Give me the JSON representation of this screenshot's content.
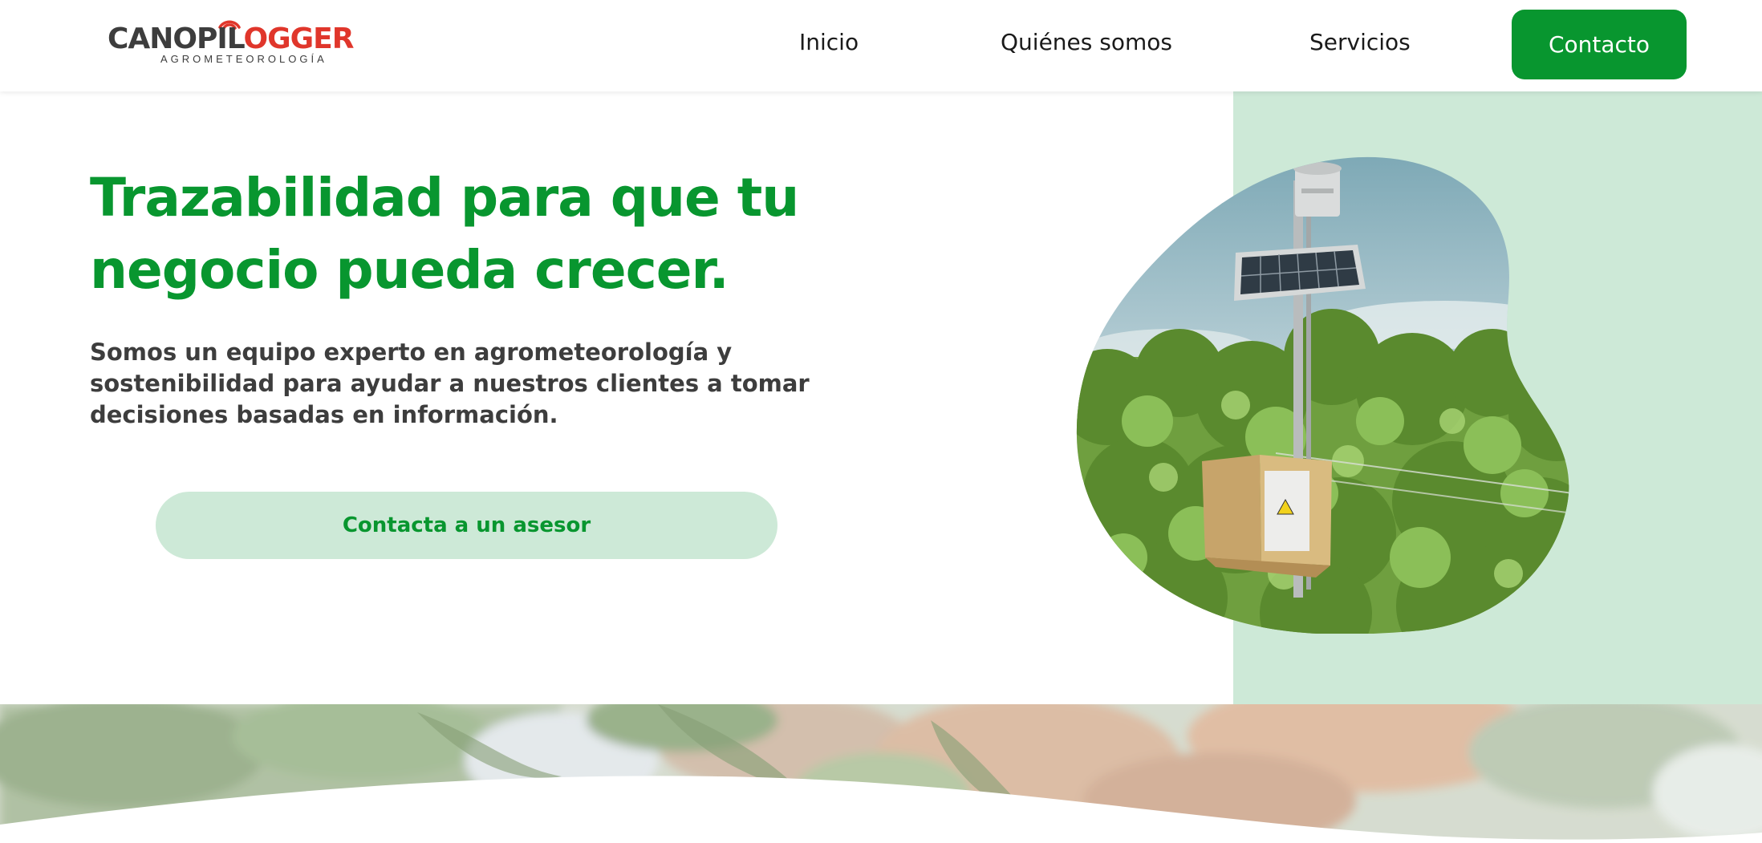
{
  "brand": {
    "logo_main_part1": "CANOPIL",
    "logo_main_o": "O",
    "logo_main_part2": "GGER",
    "logo_tagline": "AGROMETEOROLOGÍA",
    "colors": {
      "green": "#08962f",
      "light_green": "#cde9d7",
      "red": "#e0362b",
      "text_dark": "#3d3d3d"
    }
  },
  "nav": {
    "items": [
      {
        "label": "Inicio"
      },
      {
        "label": "Quiénes somos"
      },
      {
        "label": "Servicios"
      }
    ],
    "cta_label": "Contacto"
  },
  "hero": {
    "title": "Trazabilidad para que tu negocio pueda crecer.",
    "subtitle": "Somos un equipo experto en agrometeorología y sostenibilidad para ayudar a nuestros clientes a tomar decisiones basadas en información.",
    "cta_label": "Contacta a un asesor",
    "image_icon": "weather-station-photo"
  },
  "banner": {
    "image_icon": "fruit-tree-photo"
  }
}
